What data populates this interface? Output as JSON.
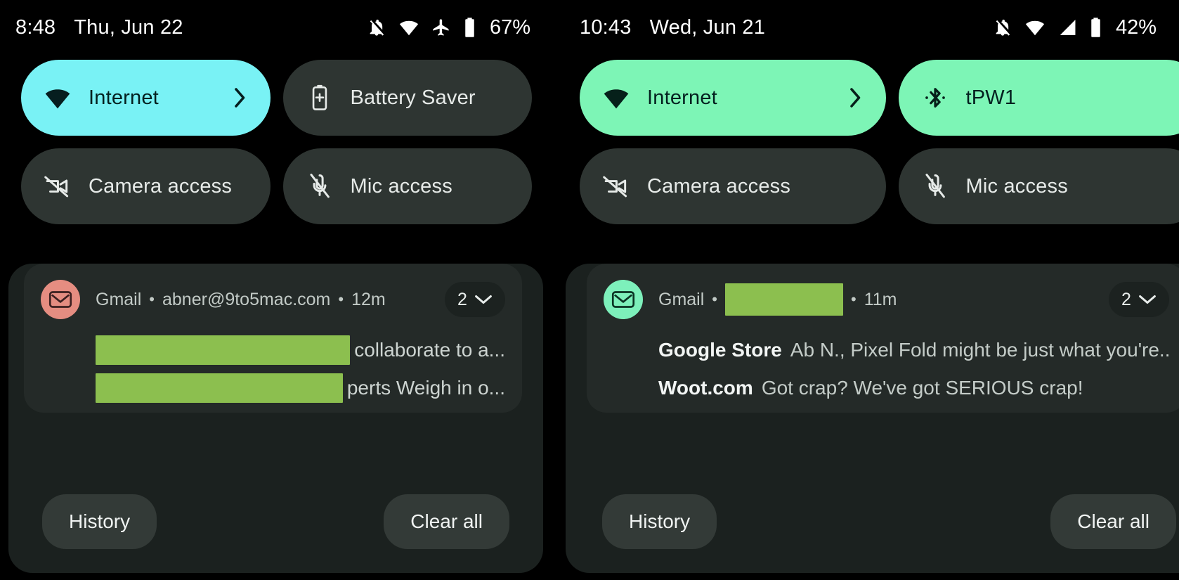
{
  "panels": [
    {
      "id": "left",
      "status_bar": {
        "time": "8:48",
        "date": "Thu, Jun 22",
        "icons": [
          "notifications-off-icon",
          "wifi-icon",
          "airplane-mode-icon",
          "battery-icon"
        ],
        "battery": "67%"
      },
      "tiles": [
        {
          "label": "Internet",
          "icon": "wifi-icon",
          "state": "active",
          "accent": "cyan",
          "chevron": true
        },
        {
          "label": "Battery Saver",
          "icon": "battery-saver-icon",
          "state": "inactive",
          "accent": "",
          "chevron": false
        },
        {
          "label": "Camera access",
          "icon": "camera-off-icon",
          "state": "inactive",
          "accent": "",
          "chevron": false
        },
        {
          "label": "Mic access",
          "icon": "mic-off-icon",
          "state": "inactive",
          "accent": "",
          "chevron": false
        }
      ],
      "notification": {
        "app": "Gmail",
        "account": "abner@9to5mac.com",
        "account_redacted": false,
        "sep1": "•",
        "sep2": "•",
        "time": "12m",
        "count": "2",
        "avatar_color": "#e58d81",
        "lines": [
          {
            "redacted": true,
            "sender": "",
            "text": "collaborate to a..."
          },
          {
            "redacted": true,
            "sender": "",
            "text": "perts Weigh in o..."
          }
        ]
      },
      "actions": {
        "history": "History",
        "clear_all": "Clear all"
      }
    },
    {
      "id": "right",
      "status_bar": {
        "time": "10:43",
        "date": "Wed, Jun 21",
        "icons": [
          "notifications-off-icon",
          "wifi-icon",
          "cellular-signal-icon",
          "battery-icon"
        ],
        "battery": "42%"
      },
      "tiles": [
        {
          "label": "Internet",
          "icon": "wifi-icon",
          "state": "active",
          "accent": "mint",
          "chevron": true
        },
        {
          "label": "tPW1",
          "icon": "bluetooth-icon",
          "state": "active",
          "accent": "mint",
          "chevron": false
        },
        {
          "label": "Camera access",
          "icon": "camera-off-icon",
          "state": "inactive",
          "accent": "",
          "chevron": false
        },
        {
          "label": "Mic access",
          "icon": "mic-off-icon",
          "state": "inactive",
          "accent": "",
          "chevron": false
        }
      ],
      "notification": {
        "app": "Gmail",
        "account": "",
        "account_redacted": true,
        "sep1": "•",
        "sep2": "•",
        "time": "11m",
        "count": "2",
        "avatar_color": "#7df0bb",
        "lines": [
          {
            "redacted": false,
            "sender": "Google Store",
            "text": "Ab N., Pixel Fold might be just what you're..."
          },
          {
            "redacted": false,
            "sender": "Woot.com",
            "text": "Got crap? We've got SERIOUS crap!"
          }
        ]
      },
      "actions": {
        "history": "History",
        "clear_all": "Clear all"
      }
    }
  ],
  "colors": {
    "background": "#000000",
    "tile_inactive": "#2e3532",
    "tile_active_cyan": "#79f2f5",
    "tile_active_mint": "#7df5b6",
    "shade_background": "#1b211f",
    "notif_card": "#242a28",
    "redaction": "#8cbf4f",
    "text_primary": "#ffffff",
    "text_secondary": "#c2cac6"
  }
}
